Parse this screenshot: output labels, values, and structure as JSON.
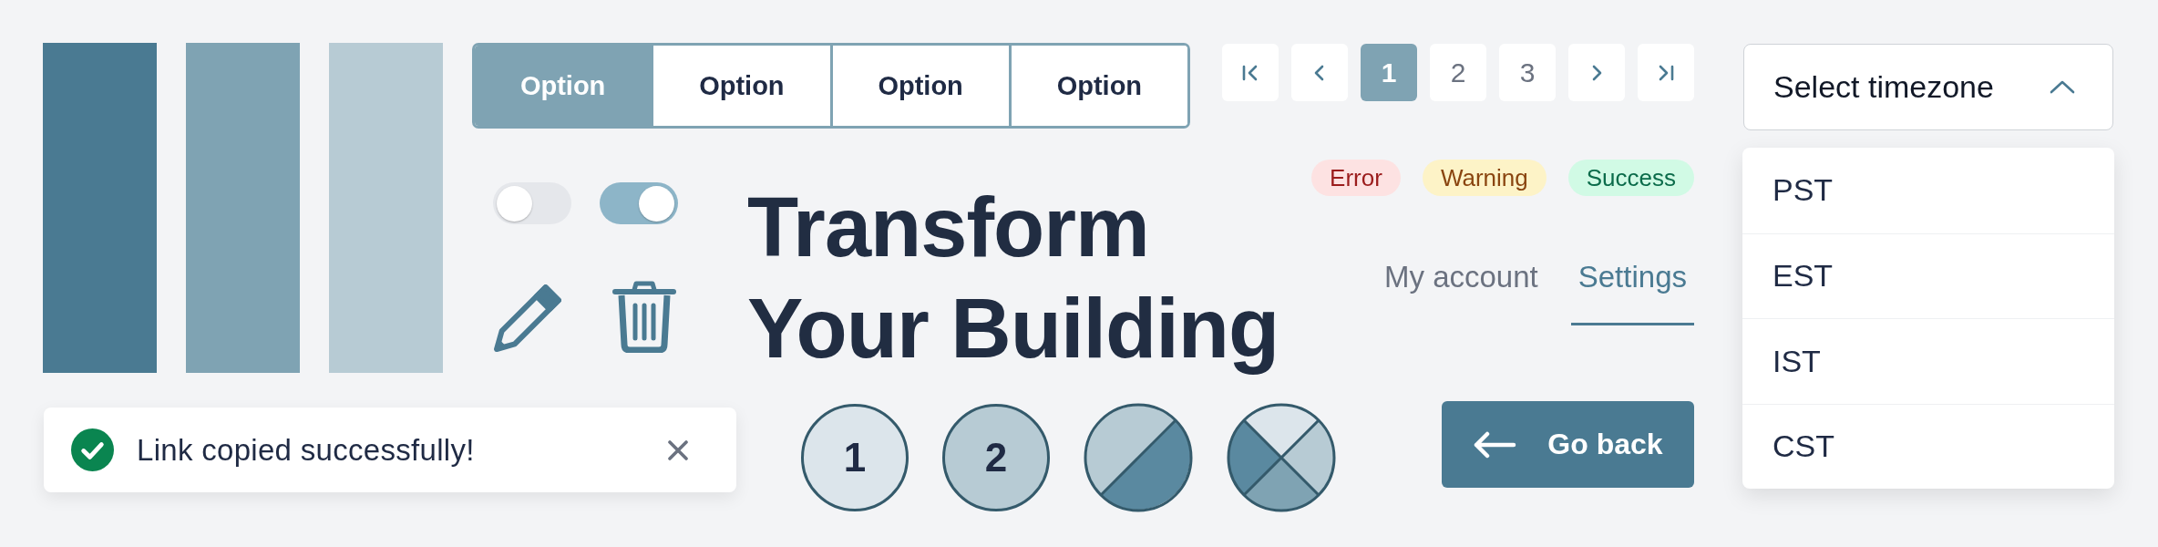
{
  "swatches": [
    {
      "color": "#4a7a92"
    },
    {
      "color": "#7fa3b3"
    },
    {
      "color": "#b7cbd4"
    }
  ],
  "segmented": [
    {
      "label": "Option",
      "selected": true
    },
    {
      "label": "Option",
      "selected": false
    },
    {
      "label": "Option",
      "selected": false
    },
    {
      "label": "Option",
      "selected": false
    }
  ],
  "toggles": [
    {
      "on": false
    },
    {
      "on": true
    }
  ],
  "title": "Transform Your Building",
  "pagination": {
    "pages": [
      {
        "label": "1",
        "selected": true
      },
      {
        "label": "2",
        "selected": false
      },
      {
        "label": "3",
        "selected": false
      }
    ]
  },
  "badges": [
    {
      "kind": "error",
      "label": "Error"
    },
    {
      "kind": "warning",
      "label": "Warning"
    },
    {
      "kind": "success",
      "label": "Success"
    }
  ],
  "nav_tabs": [
    {
      "label": "My account",
      "selected": false
    },
    {
      "label": "Settings",
      "selected": true
    }
  ],
  "timezone_select": {
    "placeholder": "Select timezone",
    "expanded": true,
    "options": [
      {
        "label": "PST",
        "selected": false
      },
      {
        "label": "EST",
        "selected": false
      },
      {
        "label": "IST",
        "selected": false
      },
      {
        "label": "CST",
        "selected": false
      }
    ]
  },
  "toast": {
    "message": "Link copied successfully!"
  },
  "steps": [
    {
      "kind": "number",
      "label": "1",
      "color": "#dce5eb"
    },
    {
      "kind": "number",
      "label": "2",
      "color": "#b7cbd4"
    },
    {
      "kind": "halves"
    },
    {
      "kind": "quarters"
    }
  ],
  "back_button": {
    "label": "Go back"
  }
}
